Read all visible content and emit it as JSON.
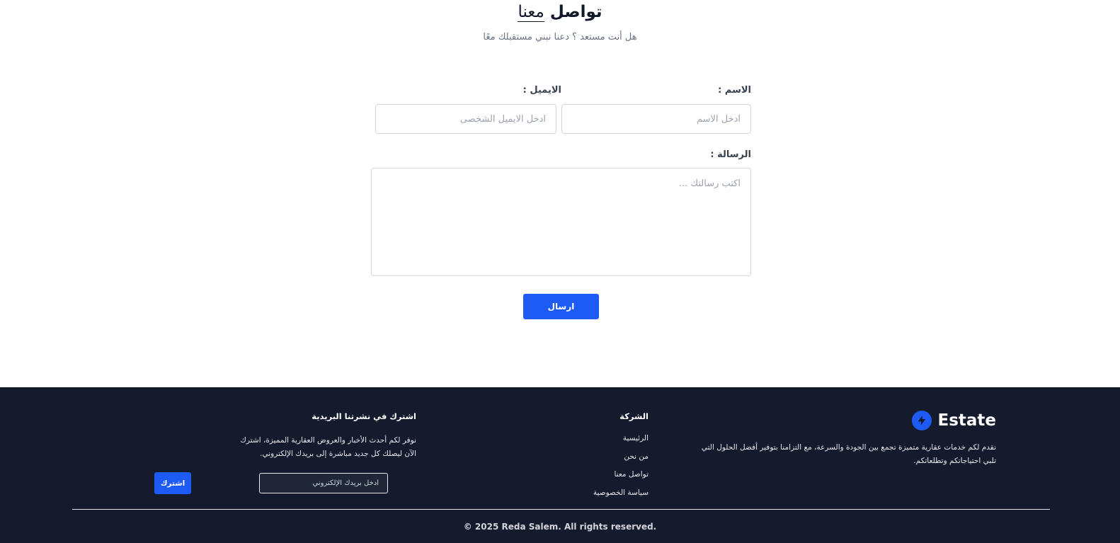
{
  "contact": {
    "title_main": "تواصل",
    "title_accent": "معنا",
    "subtitle": "هل أنت مستعد ؟ دعنا نبني مستقبلك معًا",
    "name_label": "الاسم :",
    "name_placeholder": "ادخل الاسم",
    "email_label": "الايميل :",
    "email_placeholder": "ادخل الايميل الشخصى",
    "message_label": "الرسالة :",
    "message_placeholder": "اكتب رسالتك ...",
    "send_label": "ارسال"
  },
  "footer": {
    "brand_name": "Estate",
    "brand_description": "نقدم لكم خدمات عقارية متميزة تجمع بين الجودة والسرعة، مع التزامنا بتوفير أفضل الحلول التي تلبي احتياجاتكم وتطلعاتكم.",
    "company_title": "الشركة",
    "company_links": [
      "الرئيسية",
      "من نحن",
      "تواصل معنا",
      "سياسة الخصوصية"
    ],
    "newsletter_title": "اشترك في نشرتنا البريدية",
    "newsletter_description": "نوفر لكم أحدث الأخبار والعروض العقارية المميزة، اشترك الآن ليصلك كل جديد مباشرة إلى بريدك الإلكتروني.",
    "newsletter_placeholder": "أدخل بريدك الإلكتروني",
    "subscribe_label": "اشترك",
    "copyright": "© 2025 Reda Salem. All rights reserved."
  },
  "colors": {
    "accent": "#1e5bf5",
    "footer_bg": "#141b2d"
  }
}
